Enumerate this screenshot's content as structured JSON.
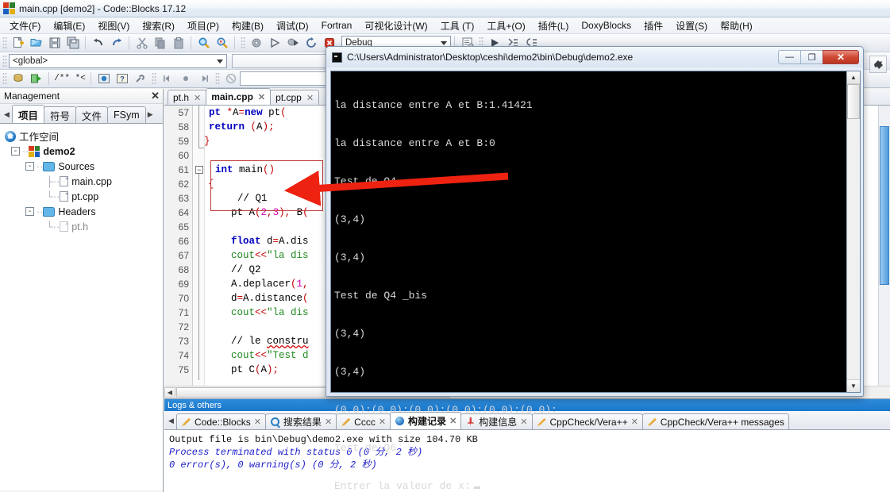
{
  "window": {
    "title": "main.cpp [demo2] - Code::Blocks 17.12",
    "logo_icon": "codeblocks-logo-icon"
  },
  "menu": {
    "items": [
      "文件(F)",
      "编辑(E)",
      "视图(V)",
      "搜索(R)",
      "项目(P)",
      "构建(B)",
      "调试(D)",
      "Fortran",
      "可视化设计(W)",
      "工具 (T)",
      "工具+(O)",
      "插件(L)",
      "DoxyBlocks",
      "插件",
      "设置(S)",
      "帮助(H)"
    ]
  },
  "toolbar": {
    "build_target": "Debug",
    "scope_selector": "<global>",
    "search_value": "",
    "goto_value": ""
  },
  "management": {
    "title": "Management",
    "close_label": "✕",
    "tabs": [
      {
        "label": "项目",
        "active": true
      },
      {
        "label": "符号",
        "active": false
      },
      {
        "label": "文件",
        "active": false
      },
      {
        "label": "FSym",
        "active": false
      }
    ],
    "tree": [
      {
        "label": "工作空间",
        "icon": "workspace-icon",
        "depth": 0,
        "expander": "",
        "bold": false,
        "dim": false
      },
      {
        "label": "demo2",
        "icon": "project-icon",
        "depth": 1,
        "expander": "-",
        "bold": true,
        "dim": false
      },
      {
        "label": "Sources",
        "icon": "folder-icon",
        "depth": 2,
        "expander": "-",
        "bold": false,
        "dim": false
      },
      {
        "label": "main.cpp",
        "icon": "file-icon",
        "depth": 3,
        "expander": "",
        "bold": false,
        "dim": false
      },
      {
        "label": "pt.cpp",
        "icon": "file-icon",
        "depth": 3,
        "expander": "",
        "bold": false,
        "dim": false
      },
      {
        "label": "Headers",
        "icon": "folder-icon",
        "depth": 2,
        "expander": "-",
        "bold": false,
        "dim": false
      },
      {
        "label": "pt.h",
        "icon": "file-icon",
        "depth": 3,
        "expander": "",
        "bold": false,
        "dim": true
      }
    ]
  },
  "editor": {
    "tabs": [
      {
        "label": "pt.h",
        "active": false
      },
      {
        "label": "main.cpp",
        "active": true
      },
      {
        "label": "pt.cpp",
        "active": false
      }
    ],
    "close_glyph": "✕",
    "first_line": 57,
    "lines": [
      {
        "no": "57",
        "text": "    pt *A=new pt("
      },
      {
        "no": "58",
        "text": "    return (A);"
      },
      {
        "no": "59",
        "text": "}"
      },
      {
        "no": "60",
        "text": ""
      },
      {
        "no": "61",
        "text": "int main()"
      },
      {
        "no": "62",
        "text": "{"
      },
      {
        "no": "63",
        "text": "    // Q1"
      },
      {
        "no": "64",
        "text": "    pt A(2,3), B("
      },
      {
        "no": "65",
        "text": ""
      },
      {
        "no": "66",
        "text": "    float d=A.dis"
      },
      {
        "no": "67",
        "text": "    cout<<\"la dis"
      },
      {
        "no": "68",
        "text": "    // Q2"
      },
      {
        "no": "69",
        "text": "    A.deplacer(1,"
      },
      {
        "no": "70",
        "text": "    d=A.distance("
      },
      {
        "no": "71",
        "text": "    cout<<\"la dis"
      },
      {
        "no": "72",
        "text": ""
      },
      {
        "no": "73",
        "text": "    // le constru"
      },
      {
        "no": "74",
        "text": "    cout<<\"Test d"
      },
      {
        "no": "75",
        "text": "    pt C(A);"
      }
    ]
  },
  "console": {
    "title": "C:\\Users\\Administrator\\Desktop\\ceshi\\demo2\\bin\\Debug\\demo2.exe",
    "icon": "cmd-icon",
    "minimize_label": "—",
    "maximize_label": "❐",
    "close_label": "✕",
    "lines": [
      "la distance entre A et B:1.41421",
      "la distance entre A et B:0",
      "Test de Q4",
      "(3,4)",
      "(3,4)",
      "Test de Q4 _bis",
      "(3,4)",
      "(3,4)",
      "(0,0);(0,0);(0,0);(0,0);(0,0);(0,0);",
      "Test de Q6",
      "Entrer la valeur de x:"
    ]
  },
  "logs": {
    "panel_title": "Logs & others",
    "tabs": [
      {
        "label": "Code::Blocks",
        "icon": "pencil-icon",
        "active": false,
        "closable": true
      },
      {
        "label": "搜索结果",
        "icon": "magnifier-icon",
        "active": false,
        "closable": true
      },
      {
        "label": "Cccc",
        "icon": "pencil-icon",
        "active": false,
        "closable": true
      },
      {
        "label": "构建记录",
        "icon": "blue-dot-icon",
        "active": true,
        "closable": true
      },
      {
        "label": "构建信息",
        "icon": "pin-icon",
        "active": false,
        "closable": true
      },
      {
        "label": "CppCheck/Vera++",
        "icon": "pencil-icon",
        "active": false,
        "closable": true
      },
      {
        "label": "CppCheck/Vera++ messages",
        "icon": "pencil-icon",
        "active": false,
        "closable": false
      }
    ],
    "close_glyph": "✕",
    "output": [
      {
        "text": "Output file is bin\\Debug\\demo2.exe with size 104.70 KB",
        "style": "plain"
      },
      {
        "text": "Process terminated with status 0 (0 分, 2 秒)",
        "style": "blue"
      },
      {
        "text": "0 error(s), 0 warning(s) (0 分, 2 秒)",
        "style": "blue"
      }
    ]
  },
  "annotation": {
    "arrow_color": "#ee2211",
    "highlight_color": "#c03a3a"
  },
  "icons": {
    "new_file": "new-file-icon",
    "open": "open-folder-icon",
    "save": "save-icon",
    "save_all": "save-all-icon",
    "undo": "undo-icon",
    "redo": "redo-icon",
    "cut": "cut-icon",
    "copy": "copy-icon",
    "paste": "paste-icon",
    "find": "find-icon",
    "replace": "replace-icon",
    "build": "build-gear-icon",
    "run": "run-icon",
    "build_and_run": "build-run-icon",
    "rebuild": "rebuild-icon",
    "abort": "abort-icon",
    "debug_window": "debug-window-icon",
    "debug_continue": "debug-continue-icon",
    "step_into": "step-into-icon",
    "step_out": "step-out-icon",
    "pin": "pin-window-icon"
  }
}
